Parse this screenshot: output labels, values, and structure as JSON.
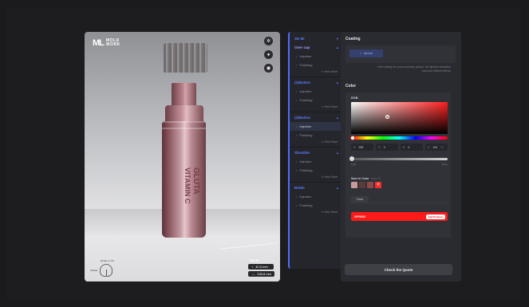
{
  "brand": {
    "mark": "ML",
    "line1": "MOLD",
    "line2": "WORK"
  },
  "bottle": {
    "line1": "GLUTA",
    "line2": "VITAMIN C"
  },
  "viewer": {
    "dims_title": "SD 80",
    "height": "40.5 mm",
    "length": "135.8 mm",
    "rotate_label": "Rotate to Tilt",
    "rotate_text": "Rotate"
  },
  "parts": {
    "header": "SD 80",
    "reset_label": "Parts Reset",
    "groups": [
      {
        "name": "Over cap",
        "items": [
          "Injection",
          "Finishing"
        ]
      },
      {
        "name": "(1)Button",
        "items": [
          "Injection",
          "Finishing"
        ]
      },
      {
        "name": "(2)Button",
        "items": [
          "Injection",
          "Finishing"
        ]
      },
      {
        "name": "Shoulder",
        "items": [
          "Injection",
          "Finishing"
        ]
      },
      {
        "name": "Bottle",
        "items": [
          "Injection",
          "Finishing"
        ]
      }
    ]
  },
  "options": {
    "coating_title": "Coating",
    "coating_button": "Spread",
    "note_line1": "* After setting the post-processing options, the injection simulation",
    "note_line2": "may have different effects",
    "color_title": "Color",
    "mode": "RGB",
    "r": "255",
    "g": "0",
    "b": "0",
    "a": "100",
    "light": "Light",
    "deep": "Deep",
    "saved_title": "Save In Color",
    "saved_hint": "max 12",
    "tab": "Color",
    "hex": "#FF0000",
    "hex_button": "Add Pantone",
    "colors": {
      "swatch1": "#c79a9a",
      "swatch2": "#5a3a3a",
      "swatch3": "#8a4a4a",
      "accent": "#ff1a1a"
    }
  },
  "quote_button": "Check the Quote"
}
